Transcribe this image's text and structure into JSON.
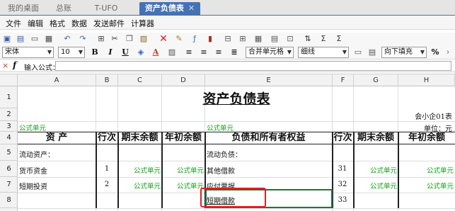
{
  "tabs": [
    {
      "label": "我的桌面",
      "active": false
    },
    {
      "label": "总账",
      "active": false
    },
    {
      "label": "T-UFO",
      "active": false
    },
    {
      "label": "资产负债表",
      "active": true,
      "close": "✕"
    }
  ],
  "menu": [
    "文件",
    "编辑",
    "格式",
    "数据",
    "发送邮件",
    "计算器"
  ],
  "format_bar": {
    "font": "宋体",
    "size": "10",
    "bold": "B",
    "italic": "I",
    "underline": "U",
    "merge": "合并单元格",
    "border": "细线",
    "fill": "向下填充",
    "percent": "%"
  },
  "formula_bar": {
    "cancel": "×",
    "fx": "f",
    "label": "输入公式：",
    "value": ""
  },
  "columns": [
    "A",
    "B",
    "C",
    "D",
    "E",
    "F",
    "G",
    "H"
  ],
  "rows": [
    "1",
    "2",
    "3",
    "4",
    "5",
    "6",
    "7",
    "8"
  ],
  "sheet": {
    "title": "资产负债表",
    "r2_right": "会小企01表",
    "r3_a": "公式单元",
    "r3_e": "公式单元",
    "r3_right": "单位：元",
    "head_a": "资        产",
    "head_b": "行次",
    "head_c": "期末余额",
    "head_d": "年初余额",
    "head_e": "负债和所有者权益",
    "head_f": "行次",
    "head_g": "期末余额",
    "head_h": "年初余额",
    "r5_a": "流动资产：",
    "r5_e": "流动负债：",
    "r6_a": "货币资金",
    "r6_b": "1",
    "r6_c": "公式单元",
    "r6_d": "公式单元",
    "r6_e": "其他借款",
    "r6_f": "31",
    "r6_g": "公式单元",
    "r6_h": "公式单元",
    "r7_a": "短期投资",
    "r7_b": "2",
    "r7_c": "公式单元",
    "r7_d": "公式单元",
    "r7_e": "应付票据",
    "r7_f": "32",
    "r7_g": "公式单元",
    "r7_h": "公式单元",
    "r8_e": "短期借款",
    "r8_f": "33"
  },
  "colors": {
    "active_tab": "#4472b4",
    "formula_text": "#19a01f",
    "selection_border": "#217346",
    "highlight": "#e02020"
  }
}
